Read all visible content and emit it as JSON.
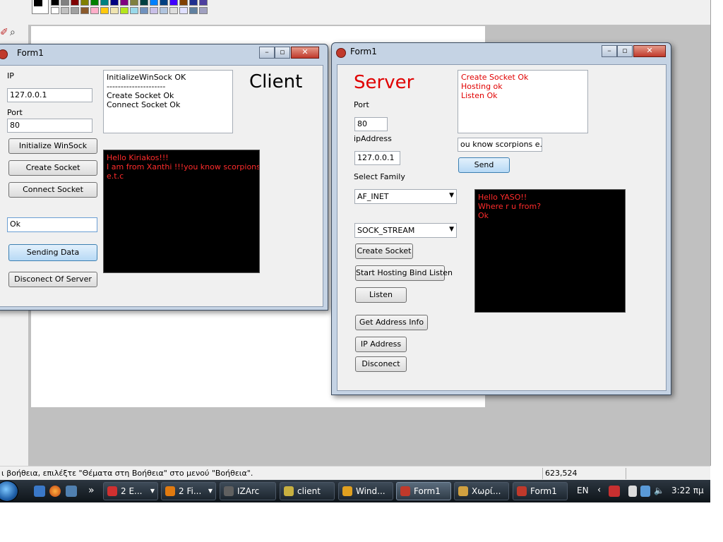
{
  "paint": {
    "status_text": "ι βοήθεια, επιλέξτε \"Θέματα στη Βοήθεια\" στο μενού \"Βοήθεια\".",
    "coordinates": "623,524",
    "palette_row1": [
      "#000000",
      "#808080",
      "#800000",
      "#808000",
      "#008000",
      "#008080",
      "#000080",
      "#800080",
      "#808040",
      "#004040",
      "#0080ff",
      "#004080",
      "#4000ff",
      "#804000",
      "#1f2f8f",
      "#4d3f9f"
    ],
    "palette_row2": [
      "#ffffff",
      "#c0c0c0",
      "#a0a0a0",
      "#8b5a2b",
      "#ffaec9",
      "#ffc90e",
      "#efe4b0",
      "#b5e61d",
      "#99d9ea",
      "#7092be",
      "#c8bfe7",
      "#b0c4de",
      "#dcdcdc",
      "#e0e0ff",
      "#6080a0",
      "#a0a0c0"
    ]
  },
  "client_window": {
    "title": "Form1",
    "heading": "Client",
    "ip_label": "IP",
    "ip_value": "127.0.0.1",
    "port_label": "Port",
    "port_value": "80",
    "btn_init": "Initialize WinSock",
    "btn_create": "Create Socket",
    "btn_connect": "Connect Socket",
    "message_value": "Ok",
    "btn_send": "Sending Data",
    "btn_disconnect": "Disconect Of  Server",
    "log": [
      "InitializeWinSock OK",
      "---------------------",
      "Create Socket Ok",
      "Connect Socket Ok"
    ],
    "chat": [
      "Hello Kiriakos!!!",
      "I am from Xanthi !!!you know scorpions",
      "e.t.c"
    ],
    "chat_color": "#ff2b2b"
  },
  "server_window": {
    "title": "Form1",
    "heading": "Server",
    "heading_color": "#e00000",
    "port_label": "Port",
    "port_value": "80",
    "ip_label": "ipAddress",
    "ip_value": "127.0.0.1",
    "family_label": "Select Family",
    "family_value": "AF_INET",
    "socktype_value": "SOCK_STREAM",
    "btn_create": "Create Socket",
    "btn_host": "Start Hosting Bind Listen",
    "btn_listen": "Listen",
    "btn_addrinfo": "Get Address Info",
    "btn_ipaddr": "IP Address",
    "btn_disconnect": "Disconect",
    "log": [
      "Create Socket Ok",
      "Hosting ok",
      "Listen Ok"
    ],
    "log_color": "#e00000",
    "message_value": "ou know scorpions e.t.c",
    "btn_send": "Send",
    "chat": [
      "Hello YASO!!",
      "Where r u from?",
      "Ok"
    ]
  },
  "taskbar": {
    "tasks": [
      {
        "label": "2 E...",
        "icon_color": "#d03030",
        "dropdown": true
      },
      {
        "label": "2 Fi...",
        "icon_color": "#e07a10",
        "dropdown": true
      },
      {
        "label": "IZArc",
        "icon_color": "#606060",
        "dropdown": false
      },
      {
        "label": "client",
        "icon_color": "#c8b040",
        "dropdown": false
      },
      {
        "label": "Wind...",
        "icon_color": "#e0a020",
        "dropdown": false
      },
      {
        "label": "Form1",
        "icon_color": "#c0392b",
        "dropdown": false
      },
      {
        "label": "Χωρί...",
        "icon_color": "#d0a040",
        "dropdown": false
      },
      {
        "label": "Form1",
        "icon_color": "#c0392b",
        "dropdown": false
      }
    ],
    "language": "EN",
    "time": "3:22 πμ",
    "overflow_chevron": "»"
  }
}
